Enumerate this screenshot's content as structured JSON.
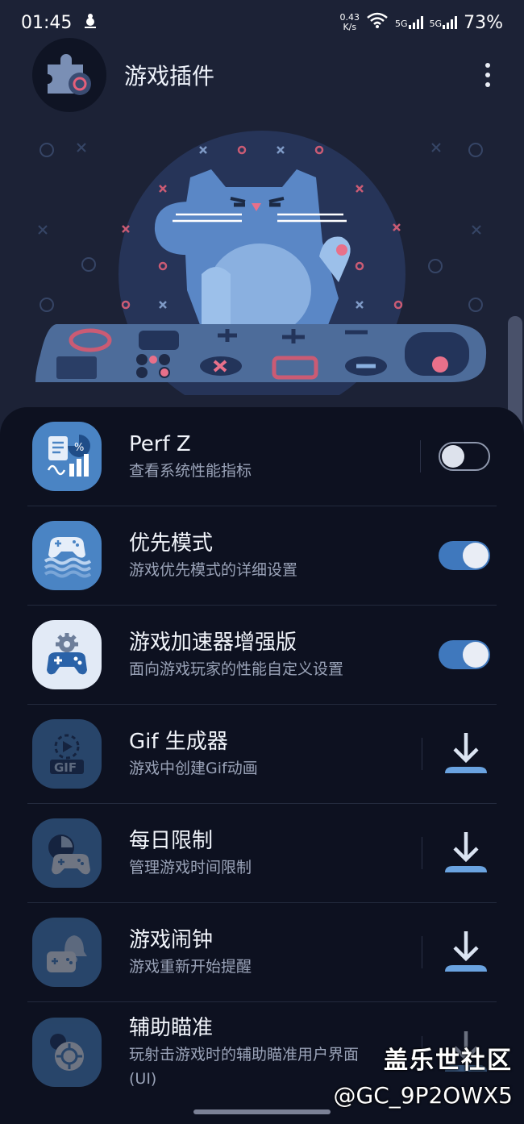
{
  "status_bar": {
    "time": "01:45",
    "net_speed_value": "0.43",
    "net_speed_unit": "K/s",
    "sig1_label": "5G",
    "sig2_label": "5G",
    "battery": "73%"
  },
  "header": {
    "title": "游戏插件"
  },
  "items": [
    {
      "title": "Perf Z",
      "subtitle": "查看系统性能指标",
      "control": "toggle",
      "state": "off"
    },
    {
      "title": "优先模式",
      "subtitle": "游戏优先模式的详细设置",
      "control": "toggle",
      "state": "on"
    },
    {
      "title": "游戏加速器增强版",
      "subtitle": "面向游戏玩家的性能自定义设置",
      "control": "toggle",
      "state": "on"
    },
    {
      "title": "Gif 生成器",
      "subtitle": "游戏中创建Gif动画",
      "control": "download"
    },
    {
      "title": "每日限制",
      "subtitle": "管理游戏时间限制",
      "control": "download"
    },
    {
      "title": "游戏闹钟",
      "subtitle": "游戏重新开始提醒",
      "control": "download"
    },
    {
      "title": "辅助瞄准",
      "subtitle": "玩射击游戏时的辅助瞄准用户界面",
      "subtitle2": "(UI)",
      "control": "download"
    }
  ],
  "icons": {
    "perf_z": "chart-report-icon",
    "priority_mode": "gamepad-waves-icon",
    "game_booster": "gamepad-gear-icon",
    "gif_maker": "gif-play-icon",
    "daily_limit": "gamepad-timer-icon",
    "game_alarm": "gamepad-bell-icon",
    "aim_assist": "crosshair-gear-icon",
    "download": "download-icon"
  },
  "watermark": {
    "line1": "盖乐世社区",
    "line2": "@GC_9P2OWX5"
  },
  "colors": {
    "background": "#1c2236",
    "list_background": "#0d1120",
    "accent_toggle": "#3f78bd",
    "download_icon": "#6aa3e0"
  }
}
